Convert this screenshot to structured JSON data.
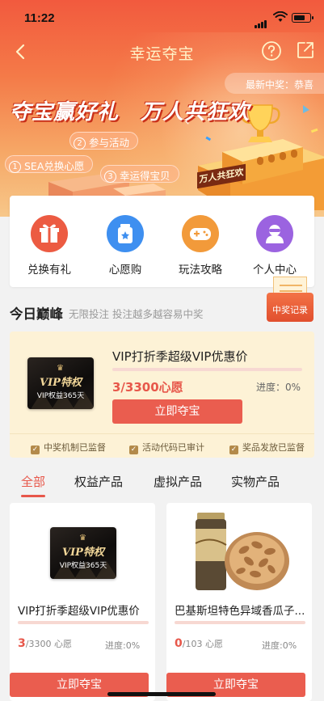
{
  "status": {
    "time": "11:22"
  },
  "nav": {
    "title": "幸运夺宝"
  },
  "hero": {
    "ticker": "最新中奖：恭喜",
    "slogan": "夺宝赢好礼　万人共狂欢",
    "steps": [
      {
        "num": "1",
        "label": "SEA兑换心愿"
      },
      {
        "num": "2",
        "label": "参与活动"
      },
      {
        "num": "3",
        "label": "幸运得宝贝"
      }
    ],
    "stage_label": "万人共狂欢"
  },
  "menu": [
    {
      "label": "兑换有礼",
      "icon": "gift-icon",
      "color": "#ec5b42"
    },
    {
      "label": "心愿购",
      "icon": "wish-jar-icon",
      "color": "#3e8ff0"
    },
    {
      "label": "玩法攻略",
      "icon": "gamepad-icon",
      "color": "#f29a3a"
    },
    {
      "label": "个人中心",
      "icon": "user-icon",
      "color": "#9b63e0"
    }
  ],
  "today": {
    "title": "今日巅峰",
    "subtitle": "无限投注 投注越多越容易中奖",
    "record_label": "中奖记录"
  },
  "featured": {
    "card": {
      "vip": "VIP特权",
      "benefit": "VIP权益365天"
    },
    "name": "VIP打折季超级VIP优惠价",
    "count": "3/3300心愿",
    "progress": "进度：0%",
    "progress_value": 0,
    "button": "立即夺宝",
    "checks": [
      "中奖机制已监督",
      "活动代码已审计",
      "奖品发放已监督"
    ]
  },
  "tabs": [
    "全部",
    "权益产品",
    "虚拟产品",
    "实物产品"
  ],
  "products": [
    {
      "card": {
        "vip": "VIP特权",
        "benefit": "VIP权益365天"
      },
      "name": "VIP打折季超级VIP优惠价",
      "count_main": "3",
      "count_rest": "/3300 心愿",
      "progress": "进度:0%",
      "button": "立即夺宝"
    },
    {
      "name": "巴基斯坦特色异域香瓜子...",
      "count_main": "0",
      "count_rest": "/103 心愿",
      "progress": "进度:0%",
      "button": "立即夺宝"
    }
  ]
}
